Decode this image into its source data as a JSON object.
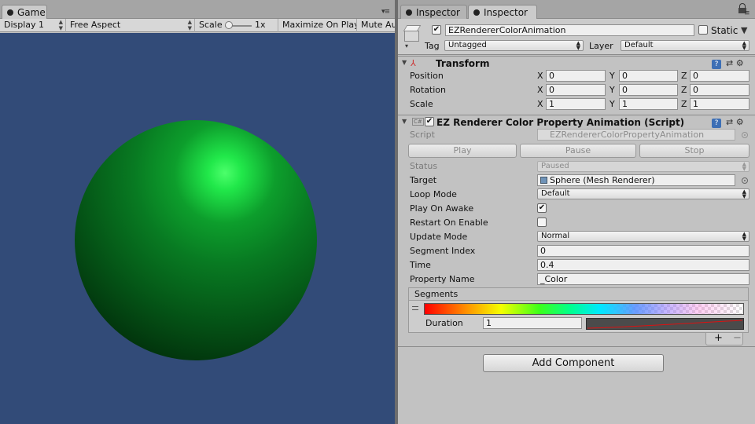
{
  "game": {
    "tab_label": "Game",
    "toolbar": {
      "display": "Display 1",
      "aspect": "Free Aspect",
      "scale_label": "Scale",
      "scale_value": "1x",
      "maximize": "Maximize On Play",
      "mute": "Mute Au"
    },
    "colors": {
      "background": "#324b78",
      "sphere": "#0d9e2c",
      "highlight": "#4cff6b"
    }
  },
  "inspector": {
    "tabs": [
      "Inspector",
      "Inspector"
    ],
    "object": {
      "name": "EZRendererColorAnimation",
      "active": true,
      "static_label": "Static",
      "static": false,
      "tag_label": "Tag",
      "tag": "Untagged",
      "layer_label": "Layer",
      "layer": "Default"
    },
    "transform": {
      "title": "Transform",
      "rows": [
        {
          "label": "Position",
          "x": "0",
          "y": "0",
          "z": "0"
        },
        {
          "label": "Rotation",
          "x": "0",
          "y": "0",
          "z": "0"
        },
        {
          "label": "Scale",
          "x": "1",
          "y": "1",
          "z": "1"
        }
      ],
      "axis": [
        "X",
        "Y",
        "Z"
      ]
    },
    "script": {
      "title": "EZ Renderer Color Property Animation (Script)",
      "enabled": true,
      "script_label": "Script",
      "script_value": "EZRendererColorPropertyAnimation",
      "buttons": [
        "Play",
        "Pause",
        "Stop"
      ],
      "fields": {
        "status_label": "Status",
        "status": "Paused",
        "target_label": "Target",
        "target": "Sphere (Mesh Renderer)",
        "loop_label": "Loop Mode",
        "loop": "Default",
        "play_awake_label": "Play On Awake",
        "play_awake": true,
        "restart_label": "Restart On Enable",
        "restart": false,
        "update_label": "Update Mode",
        "update": "Normal",
        "segment_index_label": "Segment Index",
        "segment_index": "0",
        "time_label": "Time",
        "time": "0.4",
        "property_label": "Property Name",
        "property": "_Color"
      },
      "segments": {
        "title": "Segments",
        "duration_label": "Duration",
        "duration": "1",
        "add": "+",
        "remove": "−"
      }
    },
    "add_component": "Add Component"
  }
}
